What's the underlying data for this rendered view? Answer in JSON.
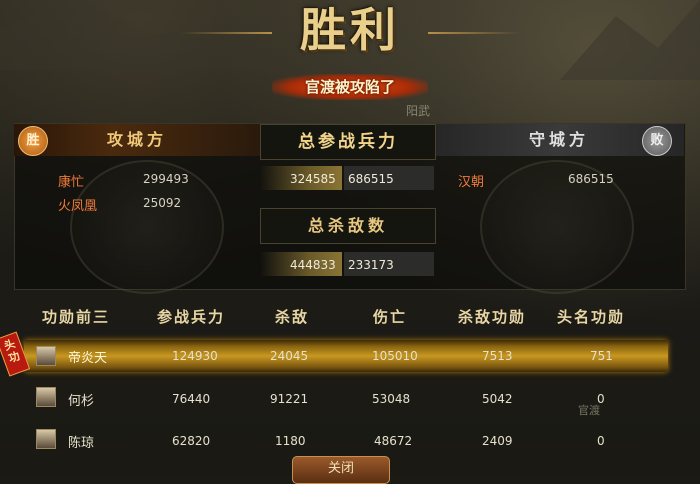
{
  "header": {
    "title": "胜利",
    "subtitle": "官渡被攻陷了"
  },
  "map_labels": {
    "yangwu": "阳武",
    "guandu": "官渡"
  },
  "attacker": {
    "header": "攻城方",
    "badge": "胜",
    "players": [
      {
        "name": "康忙",
        "troops": "299493"
      },
      {
        "name": "火凤凰",
        "troops": "25092"
      }
    ]
  },
  "defender": {
    "header": "守城方",
    "badge": "败",
    "players": [
      {
        "name": "汉朝",
        "troops": "686515"
      }
    ]
  },
  "summary": {
    "troops_header": "总参战兵力",
    "attacker_troops": "324585",
    "defender_troops": "686515",
    "kills_header": "总杀敌数",
    "attacker_kills": "444833",
    "defender_kills": "233173"
  },
  "ranking": {
    "headers": [
      "功勋前三",
      "参战兵力",
      "杀敌",
      "伤亡",
      "杀敌功勋",
      "头名功勋"
    ],
    "head_tag": "头功",
    "rows": [
      {
        "name": "帝炎天",
        "troops": "124930",
        "kills": "24045",
        "casualties": "105010",
        "kill_merit": "7513",
        "first_merit": "751"
      },
      {
        "name": "何杉",
        "troops": "76440",
        "kills": "91221",
        "casualties": "53048",
        "kill_merit": "5042",
        "first_merit": "0"
      },
      {
        "name": "陈琼",
        "troops": "62820",
        "kills": "1180",
        "casualties": "48672",
        "kill_merit": "2409",
        "first_merit": "0"
      }
    ]
  },
  "close_button": "关闭"
}
